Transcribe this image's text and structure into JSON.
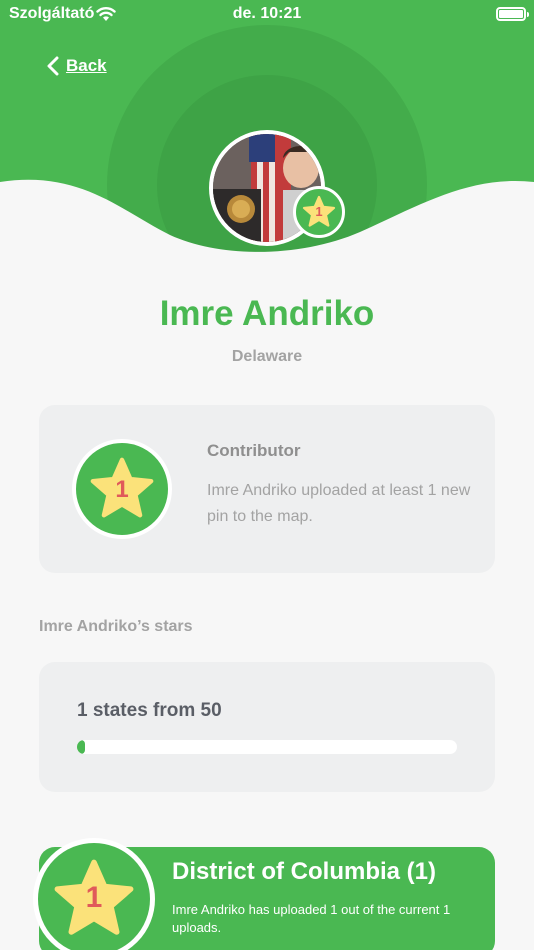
{
  "status_bar": {
    "carrier": "Szolgáltató",
    "time": "de. 10:21"
  },
  "nav": {
    "back_label": "Back"
  },
  "profile": {
    "name": "Imre Andriko",
    "location": "Delaware",
    "badge_count": "1"
  },
  "achievement": {
    "star_number": "1",
    "title": "Contributor",
    "description": "Imre Andriko uploaded at least 1 new pin to the map."
  },
  "stars_section": {
    "heading": "Imre Andriko’s stars",
    "progress_text": "1 states from 50",
    "progress_value": 1,
    "progress_max": 50
  },
  "state_list": [
    {
      "star_number": "1",
      "title": "District of Columbia (1)",
      "description": "Imre Andriko has uploaded 1 out of the current 1 uploads."
    }
  ],
  "colors": {
    "brand_green": "#4ab852",
    "star_yellow": "#fbe27a",
    "star_number_red": "#e05a5a"
  }
}
